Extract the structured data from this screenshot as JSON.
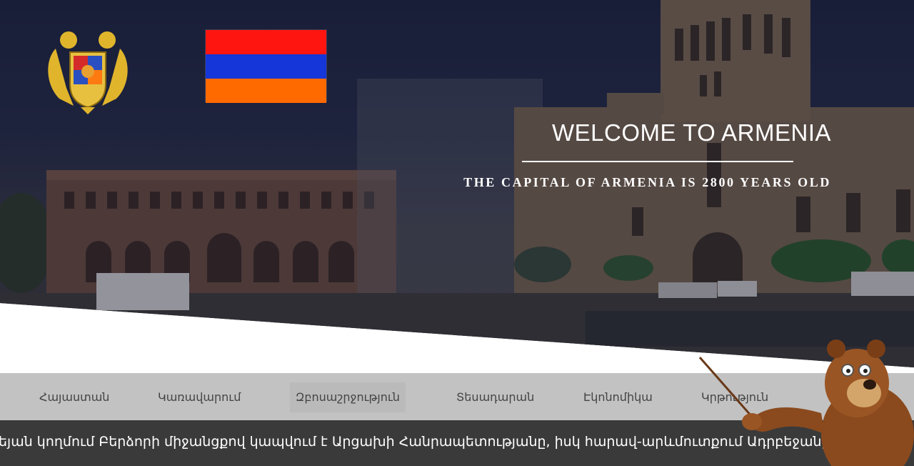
{
  "hero": {
    "title": "WELCOME TO ARMENIA",
    "subtitle": "THE CAPITAL OF ARMENIA IS 2800 YEARS OLD",
    "coat_of_arms": "armenia-coat-of-arms",
    "flag": {
      "colors": [
        "#ff1510",
        "#1536d8",
        "#ff6a00"
      ]
    }
  },
  "nav": {
    "items": [
      {
        "label": "Հայաստան"
      },
      {
        "label": "Կառավարում"
      },
      {
        "label": "Զբոսաշրջություն",
        "active": true
      },
      {
        "label": "Տեսադարան"
      },
      {
        "label": "Էկոնոմիկա"
      },
      {
        "label": "Կրթություն"
      }
    ]
  },
  "ticker": {
    "text": "եյան կողմում Բերձորի միջանցքով կապվում է Արցախի Հանրապետությանը, իսկ հարավ-արևմուտքում Ադրբեջանի"
  },
  "mascot": "bear-with-pointer"
}
